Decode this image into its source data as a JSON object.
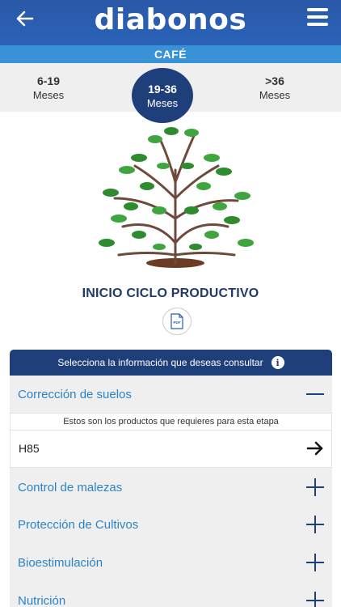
{
  "header": {
    "logo": "diabonos",
    "back_icon": "arrow-left-icon",
    "menu_icon": "hamburger-menu-icon"
  },
  "crop": {
    "name": "CAFÉ"
  },
  "stages": [
    {
      "range": "6-19",
      "unit": "Meses",
      "active": false
    },
    {
      "range": "19-36",
      "unit": "Meses",
      "active": true
    },
    {
      "range": ">36",
      "unit": "Meses",
      "active": false
    }
  ],
  "phase": {
    "title": "INICIO CICLO PRODUCTIVO",
    "pdf_label": "PDF"
  },
  "panel": {
    "header": "Selecciona la información que deseas consultar",
    "info_icon": "i",
    "sections": [
      {
        "label": "Corrección de suelos",
        "expanded": true,
        "caption": "Estos son los productos que requieres para esta etapa",
        "products": [
          {
            "name": "H85"
          }
        ]
      },
      {
        "label": "Control de malezas",
        "expanded": false
      },
      {
        "label": "Protección de Cultivos",
        "expanded": false
      },
      {
        "label": "Bioestimulación",
        "expanded": false
      },
      {
        "label": "Nutrición",
        "expanded": false
      }
    ]
  },
  "colors": {
    "header": "#2b58a8",
    "crop_bar": "#3a92d6",
    "navy": "#1f3f7a",
    "link_blue": "#2a83c8",
    "panel_bg": "#efefef"
  }
}
